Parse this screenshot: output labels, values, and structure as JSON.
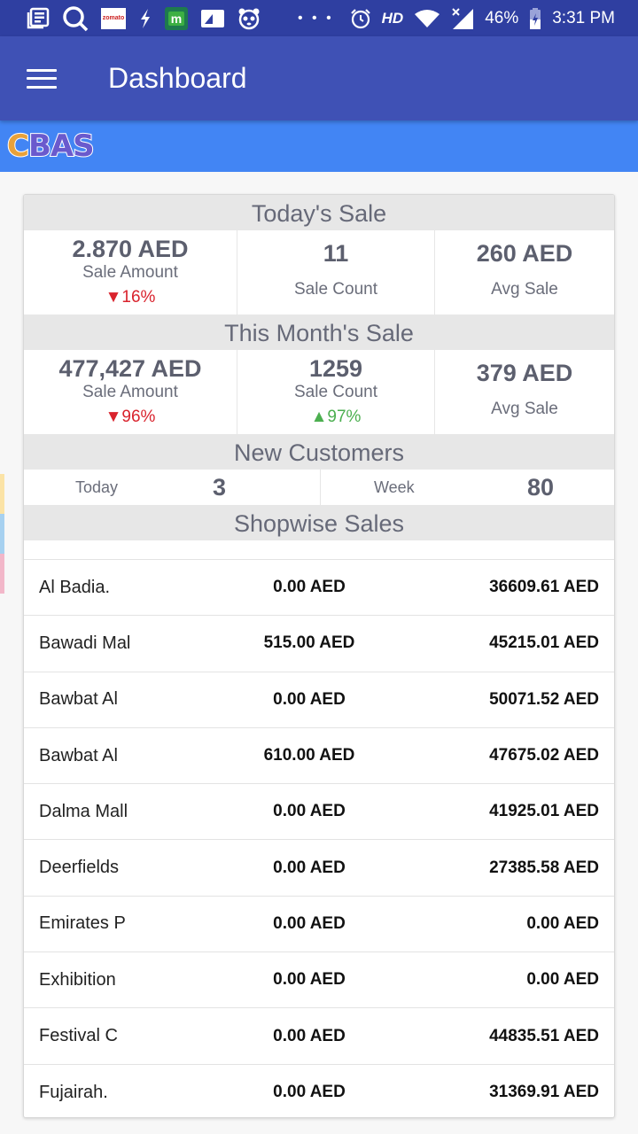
{
  "status_bar": {
    "left_icons": [
      "news-icon",
      "search-icon",
      "zomato-icon",
      "flash-icon",
      "m-app-icon",
      "photo-icon",
      "panda-icon"
    ],
    "zomato_label": "zomato",
    "m_app_label": "m",
    "overflow": "• • •",
    "hd_label": "HD",
    "battery": "46%",
    "time": "3:31 PM"
  },
  "app_bar": {
    "title": "Dashboard"
  },
  "brand": {
    "logo_c": "C",
    "logo_rest": "BAS"
  },
  "today_sale": {
    "heading": "Today's Sale",
    "sale_amount": {
      "value": "2.870 AED",
      "label": "Sale Amount",
      "change": "▼16%",
      "direction": "down"
    },
    "sale_count": {
      "value": "11",
      "label": "Sale Count"
    },
    "avg_sale": {
      "value": "260 AED",
      "label": "Avg Sale"
    }
  },
  "month_sale": {
    "heading": "This Month's Sale",
    "sale_amount": {
      "value": "477,427 AED",
      "label": "Sale Amount",
      "change": "▼96%",
      "direction": "down"
    },
    "sale_count": {
      "value": "1259",
      "label": "Sale Count",
      "change": "▲97%",
      "direction": "up"
    },
    "avg_sale": {
      "value": "379 AED",
      "label": "Avg Sale"
    }
  },
  "new_customers": {
    "heading": "New Customers",
    "today_label": "Today",
    "today_value": "3",
    "week_label": "Week",
    "week_value": "80"
  },
  "shopwise": {
    "heading": "Shopwise Sales",
    "rows": [
      {
        "name": "Al Badia.",
        "today": "0.00 AED",
        "month": "36609.61 AED"
      },
      {
        "name": "Bawadi Mal",
        "today": "515.00 AED",
        "month": "45215.01 AED"
      },
      {
        "name": "Bawbat Al",
        "today": "0.00 AED",
        "month": "50071.52 AED"
      },
      {
        "name": "Bawbat Al",
        "today": "610.00 AED",
        "month": "47675.02 AED"
      },
      {
        "name": "Dalma Mall",
        "today": "0.00 AED",
        "month": "41925.01 AED"
      },
      {
        "name": "Deerfields",
        "today": "0.00 AED",
        "month": "27385.58 AED"
      },
      {
        "name": "Emirates P",
        "today": "0.00 AED",
        "month": "0.00 AED"
      },
      {
        "name": "Exhibition",
        "today": "0.00 AED",
        "month": "0.00 AED"
      },
      {
        "name": "Festival C",
        "today": "0.00 AED",
        "month": "44835.51 AED"
      },
      {
        "name": "Fujairah.",
        "today": "0.00 AED",
        "month": "31369.91 AED"
      }
    ]
  },
  "colors": {
    "status_bar": "#2f3fa1",
    "app_bar": "#3f51b5",
    "brand_strip": "#4285f4",
    "section_header": "#e7e7e7",
    "down": "#d9232d",
    "up": "#4caf50"
  }
}
